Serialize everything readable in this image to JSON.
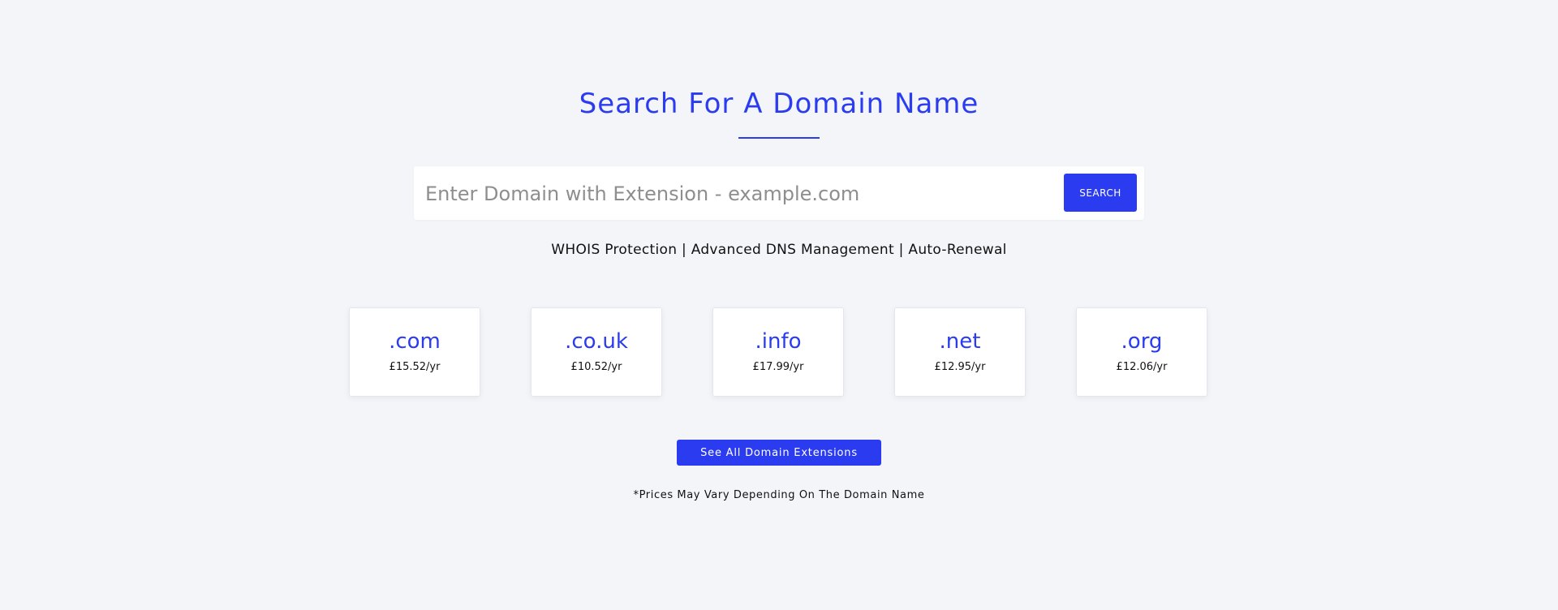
{
  "colors": {
    "accent": "#2b3cf0",
    "background": "#f3f5f9",
    "card": "#ffffff"
  },
  "header": {
    "title": "Search For A Domain Name"
  },
  "search": {
    "placeholder": "Enter Domain with Extension - example.com",
    "value": "",
    "button_label": "SEARCH"
  },
  "features_text": "WHOIS Protection | Advanced DNS Management | Auto-Renewal",
  "tlds": [
    {
      "name": ".com",
      "price": "£15.52/yr"
    },
    {
      "name": ".co.uk",
      "price": "£10.52/yr"
    },
    {
      "name": ".info",
      "price": "£17.99/yr"
    },
    {
      "name": ".net",
      "price": "£12.95/yr"
    },
    {
      "name": ".org",
      "price": "£12.06/yr"
    }
  ],
  "all_extensions_label": "See All Domain Extensions",
  "note": "*Prices May Vary Depending On The Domain Name"
}
